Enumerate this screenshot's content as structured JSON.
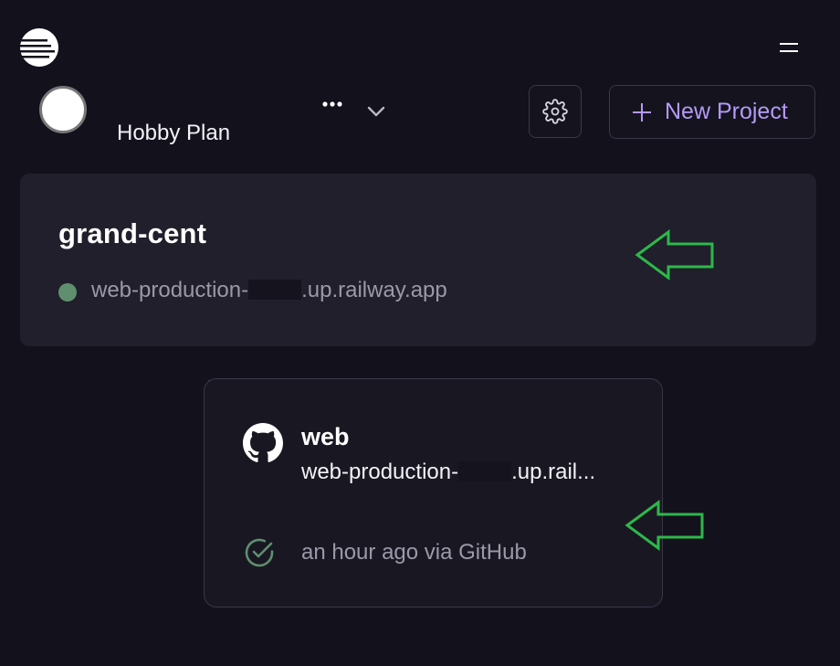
{
  "header": {
    "logo_icon": "railway-logo-icon",
    "menu_icon": "hamburger-menu-icon"
  },
  "workspace": {
    "plan_label": "Hobby Plan",
    "more_icon": "more-dots-icon",
    "chevron_icon": "chevron-down-icon"
  },
  "toolbar": {
    "settings_icon": "gear-icon",
    "new_project_label": "New Project",
    "new_project_icon": "plus-icon"
  },
  "project": {
    "name": "grand-cent",
    "url_prefix": "web-production-",
    "url_suffix": ".up.railway.app",
    "status_color": "#5f8f6f"
  },
  "service": {
    "name": "web",
    "url_prefix": "web-production-",
    "url_suffix": ".up.rail...",
    "deploy_status": "an hour ago via GitHub",
    "source_icon": "github-icon",
    "status_icon": "check-circle-icon"
  },
  "colors": {
    "background": "#13111c",
    "card": "#201f2b",
    "accent": "#b39af7",
    "annotation_arrow": "#2db84a"
  }
}
